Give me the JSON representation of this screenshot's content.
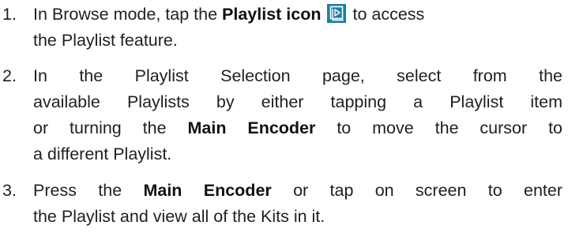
{
  "steps": [
    {
      "number": "1.",
      "line1_pre": "In Browse mode, tap the",
      "line1_bold": "Playlist icon",
      "line1_post": "to access",
      "line2": "the Playlist feature.",
      "icon": "playlist-icon",
      "icon_color": "#1e7fa6"
    },
    {
      "number": "2.",
      "line1": "In the Playlist Selection page, select from the",
      "line2": "available Playlists by either tapping a Playlist item",
      "line3_pre": "or turning the",
      "line3_bold": "Main Encoder",
      "line3_post": "to move the cursor to",
      "line4": "a different Playlist."
    },
    {
      "number": "3.",
      "line1_pre": "Press the",
      "line1_bold": "Main Encoder",
      "line1_post": "or tap on screen to enter",
      "line2": "the Playlist and view all of the Kits in it."
    }
  ]
}
